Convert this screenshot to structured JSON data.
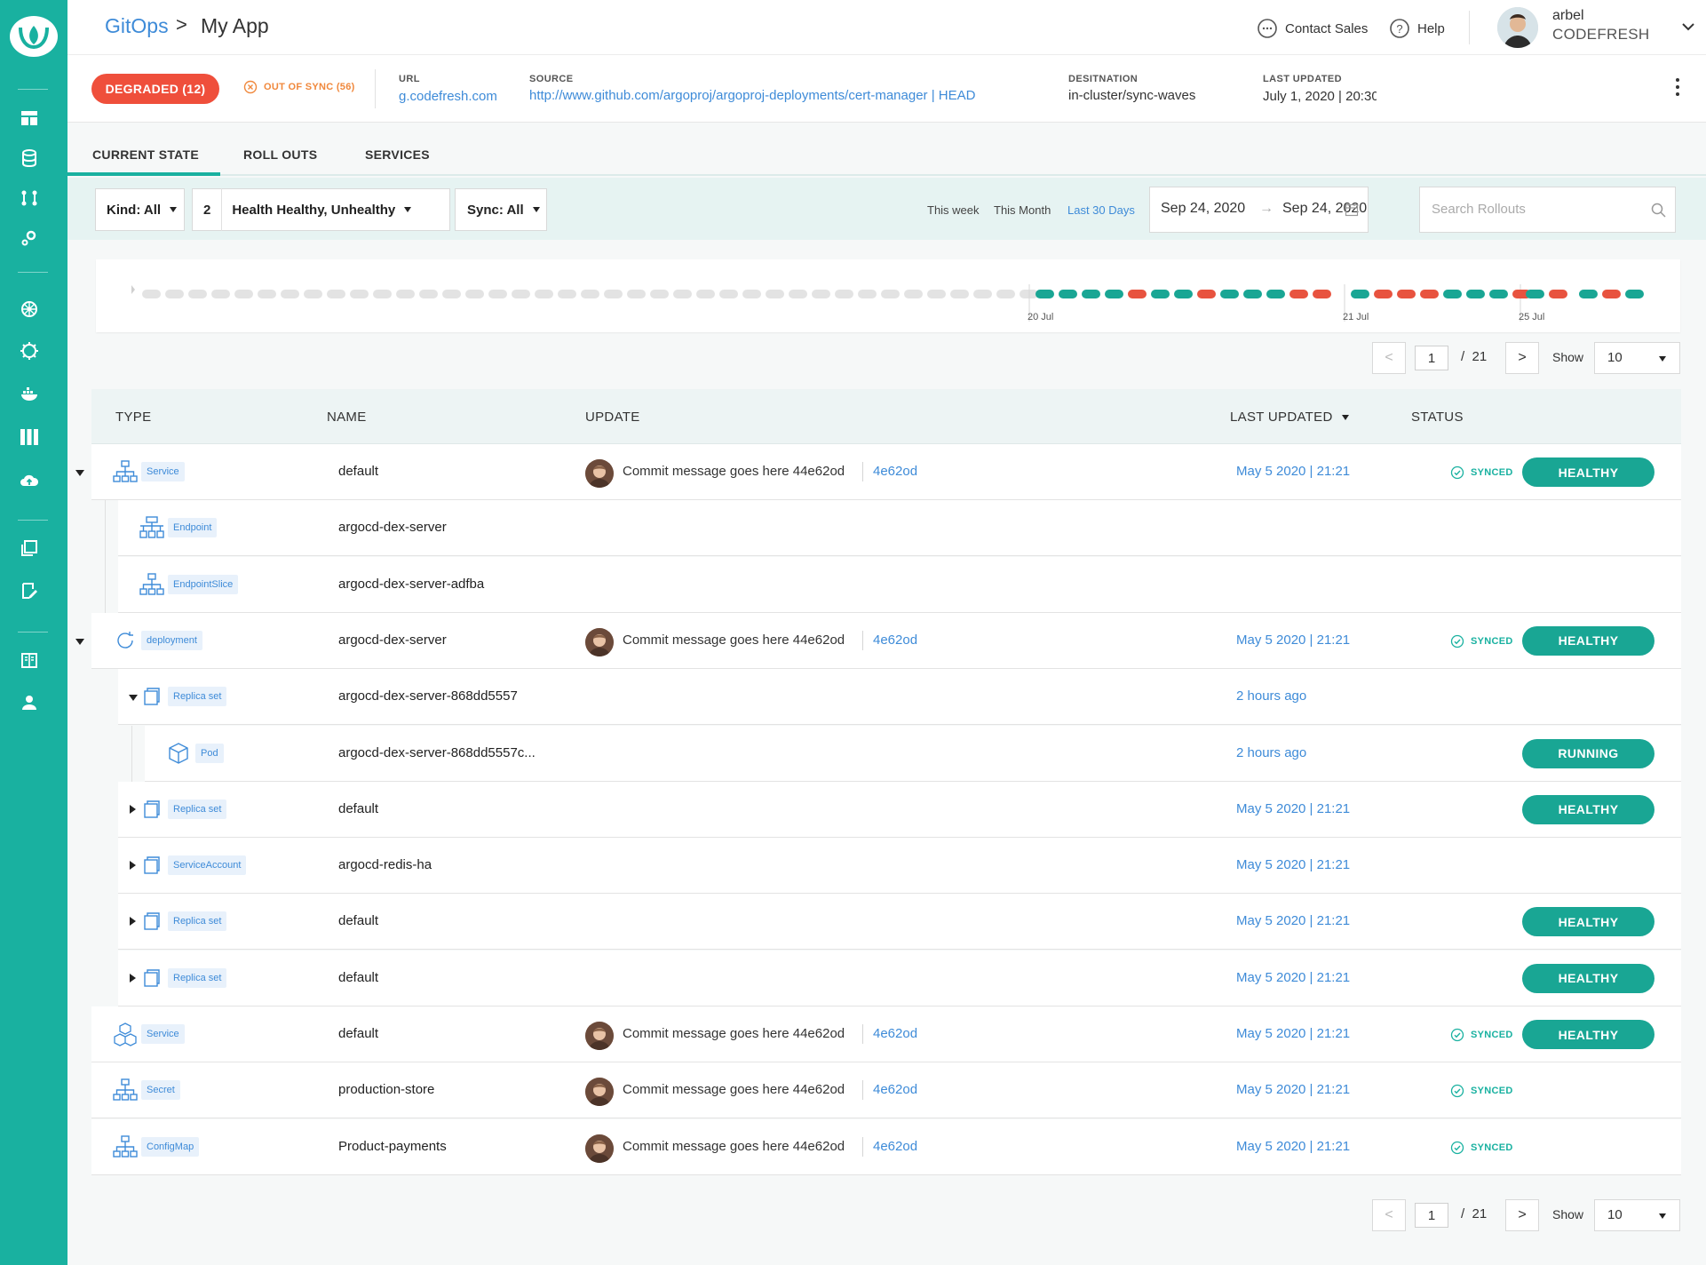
{
  "breadcrumb": {
    "root": "GitOps",
    "separator": ">",
    "current": "My App"
  },
  "header": {
    "contact_sales": "Contact Sales",
    "help": "Help",
    "user_name": "arbel",
    "user_org": "CODEFRESH"
  },
  "app_info": {
    "health_badge": "DEGRADED (12)",
    "sync_status": "OUT OF SYNC (56)",
    "url_label": "URL",
    "url_value": "g.codefresh.com",
    "source_label": "SOURCE",
    "source_value": "http://www.github.com/argoproj/argoproj-deployments/cert-manager | HEAD",
    "destination_label": "DESITNATION",
    "destination_value": "in-cluster/sync-waves",
    "last_updated_label": "LAST UPDATED",
    "last_updated_value": "July 1, 2020 | 20:30"
  },
  "tabs": [
    {
      "label": "CURRENT STATE",
      "active": true
    },
    {
      "label": "ROLL OUTS",
      "active": false
    },
    {
      "label": "SERVICES",
      "active": false
    }
  ],
  "filters": {
    "kind": "Kind: All",
    "health_count": "2",
    "health": "Health Healthy, Unhealthy",
    "sync": "Sync: All",
    "ranges": [
      "This week",
      "This Month",
      "Last 30 Days"
    ],
    "active_range": "Last 30 Days",
    "date_from": "Sep 24, 2020",
    "date_arrow": "→",
    "date_to": "Sep 24, 2020",
    "search_placeholder": "Search Rollouts"
  },
  "timeline": {
    "labels": [
      "20 Jul",
      "21 Jul",
      "25 Jul"
    ],
    "inactive_count": 39,
    "groups": [
      [
        "ok",
        "ok",
        "ok",
        "ok",
        "err",
        "ok",
        "ok",
        "err",
        "ok",
        "ok",
        "ok",
        "err",
        "err"
      ],
      [
        "ok",
        "err",
        "err",
        "err",
        "ok",
        "ok",
        "ok",
        "err"
      ],
      [
        "ok",
        "err"
      ],
      [
        "ok",
        "err",
        "ok"
      ]
    ],
    "colors": {
      "ok": "#19a694",
      "err": "#e8533f",
      "inactive": "#e3e3e3"
    }
  },
  "pagination": {
    "page": "1",
    "separator": "/",
    "total": "21",
    "show_label": "Show",
    "page_size": "10"
  },
  "table": {
    "headers": {
      "type": "TYPE",
      "name": "NAME",
      "update": "UPDATE",
      "last_updated": "LAST UPDATED",
      "status": "STATUS"
    },
    "rows": [
      {
        "depth": 0,
        "toggle": "expanded",
        "icon": "hierarchy-icon",
        "kind": "Service",
        "name": "default",
        "commit": "Commit message goes here 44e62od",
        "sha": "4e62od",
        "last_updated": "May 5 2020 | 21:21",
        "synced": "SYNCED",
        "status": "HEALTHY"
      },
      {
        "depth": 1,
        "toggle": "",
        "icon": "network-icon",
        "kind": "Endpoint",
        "name": "argocd-dex-server",
        "commit": "",
        "sha": "",
        "last_updated": "",
        "synced": "",
        "status": ""
      },
      {
        "depth": 1,
        "toggle": "",
        "icon": "hierarchy-icon",
        "kind": "EndpointSlice",
        "name": "argocd-dex-server-adfba",
        "commit": "",
        "sha": "",
        "last_updated": "",
        "synced": "",
        "status": ""
      },
      {
        "depth": 0,
        "toggle": "expanded",
        "icon": "refresh-icon",
        "kind": "deployment",
        "name": "argocd-dex-server",
        "commit": "Commit message goes here 44e62od",
        "sha": "4e62od",
        "last_updated": "May 5 2020 | 21:21",
        "synced": "SYNCED",
        "status": "HEALTHY"
      },
      {
        "depth": 1,
        "toggle": "expanded",
        "icon": "copy-icon",
        "kind": "Replica set",
        "name": "argocd-dex-server-868dd5557",
        "commit": "",
        "sha": "",
        "last_updated": "2 hours ago",
        "synced": "",
        "status": ""
      },
      {
        "depth": 2,
        "toggle": "",
        "icon": "cube-icon",
        "kind": "Pod",
        "name": "argocd-dex-server-868dd5557c...",
        "commit": "",
        "sha": "",
        "last_updated": "2 hours ago",
        "synced": "",
        "status": "RUNNING"
      },
      {
        "depth": 1,
        "toggle": "collapsed",
        "icon": "copy-icon",
        "kind": "Replica set",
        "name": "default",
        "commit": "",
        "sha": "",
        "last_updated": "May 5 2020 | 21:21",
        "synced": "",
        "status": "HEALTHY"
      },
      {
        "depth": 1,
        "toggle": "collapsed",
        "icon": "copy-icon",
        "kind": "ServiceAccount",
        "name": "argocd-redis-ha",
        "commit": "",
        "sha": "",
        "last_updated": "May 5 2020 | 21:21",
        "synced": "",
        "status": ""
      },
      {
        "depth": 1,
        "toggle": "collapsed",
        "icon": "copy-icon",
        "kind": "Replica set",
        "name": "default",
        "commit": "",
        "sha": "",
        "last_updated": "May 5 2020 | 21:21",
        "synced": "",
        "status": "HEALTHY"
      },
      {
        "depth": 1,
        "toggle": "collapsed",
        "icon": "copy-icon",
        "kind": "Replica set",
        "name": "default",
        "commit": "",
        "sha": "",
        "last_updated": "May 5 2020 | 21:21",
        "synced": "",
        "status": "HEALTHY"
      },
      {
        "depth": 0,
        "toggle": "",
        "icon": "cubes-icon",
        "kind": "Service",
        "name": "default",
        "commit": "Commit message goes here 44e62od",
        "sha": "4e62od",
        "last_updated": "May 5 2020 | 21:21",
        "synced": "SYNCED",
        "status": "HEALTHY"
      },
      {
        "depth": 0,
        "toggle": "",
        "icon": "hierarchy-icon",
        "kind": "Secret",
        "name": "production-store",
        "commit": "Commit message goes here 44e62od",
        "sha": "4e62od",
        "last_updated": "May 5 2020 | 21:21",
        "synced": "SYNCED",
        "status": ""
      },
      {
        "depth": 0,
        "toggle": "",
        "icon": "hierarchy-icon",
        "kind": "ConfigMap",
        "name": "Product-payments",
        "commit": "Commit message goes here 44e62od",
        "sha": "4e62od",
        "last_updated": "May 5 2020 | 21:21",
        "synced": "SYNCED",
        "status": ""
      }
    ]
  },
  "sidebar": {
    "icons": [
      "dashboard-icon",
      "database-icon",
      "git-icon",
      "settings-icon",
      "kubernetes-icon",
      "helm-icon",
      "docker-icon",
      "columns-icon",
      "cloud-icon",
      "layers-icon",
      "edit-icon",
      "book-icon",
      "user-icon"
    ]
  },
  "colors": {
    "accent": "#19b1a0",
    "link": "#3e8bd8",
    "danger": "#ef4f3b",
    "warning": "#f0883c"
  }
}
